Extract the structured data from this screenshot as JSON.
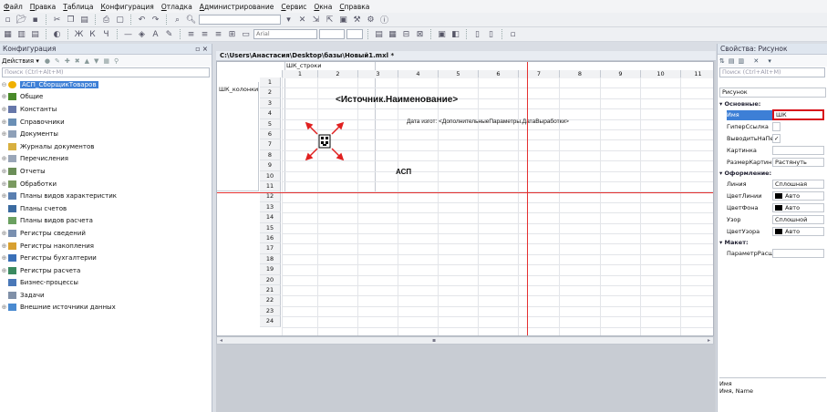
{
  "menu": [
    "Файл",
    "Правка",
    "Таблица",
    "Конфигурация",
    "Отладка",
    "Администрирование",
    "Сервис",
    "Окна",
    "Справка"
  ],
  "toolbar2": {
    "font_name": "Arial"
  },
  "left_panel": {
    "title": "Конфигурация",
    "actions_label": "Действия ▾",
    "search_placeholder": "Поиск (Ctrl+Alt+M)",
    "tree": [
      {
        "label": "АСП_СборщикТоваров",
        "root": true,
        "icon": "#f0b000"
      },
      {
        "label": "Общие",
        "icon": "#4a8a2a"
      },
      {
        "label": "Константы",
        "icon": "#6677aa"
      },
      {
        "label": "Справочники",
        "icon": "#6a8fb5"
      },
      {
        "label": "Документы",
        "icon": "#8ea0b8"
      },
      {
        "label": "Журналы документов",
        "icon": "#d8b040"
      },
      {
        "label": "Перечисления",
        "icon": "#9aa6b8"
      },
      {
        "label": "Отчеты",
        "icon": "#6b8e58"
      },
      {
        "label": "Обработки",
        "icon": "#7a9a60"
      },
      {
        "label": "Планы видов характеристик",
        "icon": "#5a7fb0"
      },
      {
        "label": "Планы счетов",
        "icon": "#3a6aa0"
      },
      {
        "label": "Планы видов расчета",
        "icon": "#6aa060"
      },
      {
        "label": "Регистры сведений",
        "icon": "#7a90b0"
      },
      {
        "label": "Регистры накопления",
        "icon": "#d8a030"
      },
      {
        "label": "Регистры бухгалтерии",
        "icon": "#3a70b8"
      },
      {
        "label": "Регистры расчета",
        "icon": "#3a8a60"
      },
      {
        "label": "Бизнес-процессы",
        "icon": "#4a78b8"
      },
      {
        "label": "Задачи",
        "icon": "#8090a8"
      },
      {
        "label": "Внешние источники данных",
        "icon": "#4a8ad0"
      }
    ]
  },
  "document": {
    "title": "C:\\Users\\Анастасия\\Desktop\\базы\\Новый1.mxl *",
    "group_row_label": "ШК_строки",
    "group_col_label": "ШК_колонки",
    "columns": [
      "1",
      "2",
      "3",
      "4",
      "5",
      "6",
      "7",
      "8",
      "9",
      "10",
      "11"
    ],
    "rows": [
      "1",
      "2",
      "3",
      "4",
      "5",
      "6",
      "7",
      "8",
      "9",
      "10",
      "11",
      "12",
      "13",
      "14",
      "15",
      "16",
      "17",
      "18",
      "19",
      "20",
      "21",
      "22",
      "23",
      "24"
    ],
    "source_name": "<Источник.Наименование>",
    "date_text": "Дата изгот: <ДополнительныеПараметры.ДатаВыработки>",
    "asp_text": "АСП"
  },
  "right_panel": {
    "title": "Свойства: Рисунок",
    "search_placeholder": "Поиск (Ctrl+Alt+M)",
    "object_type": "Рисунок",
    "section_main": "Основные:",
    "section_design": "Оформление:",
    "section_layout": "Макет:",
    "props": [
      {
        "name": "Имя",
        "value": "ШК",
        "selected": true
      },
      {
        "name": "ГиперСсылка",
        "value": ""
      },
      {
        "name": "ВыводитьНаПечать",
        "value": "✓"
      },
      {
        "name": "Картинка",
        "value": ""
      },
      {
        "name": "РазмерКартинки",
        "value": "Растянуть"
      }
    ],
    "design_props": [
      {
        "name": "Линия",
        "value": "Сплошная"
      },
      {
        "name": "ЦветЛинии",
        "value": "Авто"
      },
      {
        "name": "ЦветФона",
        "value": "Авто"
      },
      {
        "name": "Узор",
        "value": "Сплошной"
      },
      {
        "name": "ЦветУзора",
        "value": "Авто"
      }
    ],
    "layout_props": [
      {
        "name": "ПараметрРасшифровки",
        "value": ""
      }
    ],
    "help_title": "Имя",
    "help_text": "Имя, Name"
  }
}
